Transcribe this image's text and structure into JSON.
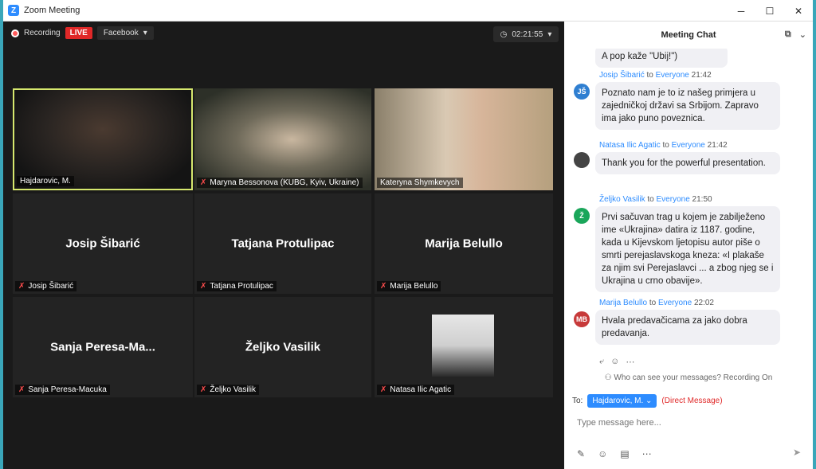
{
  "window": {
    "title": "Zoom Meeting",
    "logo": "Z"
  },
  "top": {
    "recording_label": "Recording",
    "live_label": "LIVE",
    "platform": "Facebook",
    "timer": "02:21:55"
  },
  "tiles": [
    {
      "label": "Hajdarovic, M.",
      "center": "",
      "muted": false
    },
    {
      "label": "Maryna Bessonova (KUBG, Kyiv, Ukraine)",
      "center": "",
      "muted": true
    },
    {
      "label": "Kateryna Shymkevych",
      "center": "",
      "muted": false
    },
    {
      "label": "Josip Šibarić",
      "center": "Josip Šibarić",
      "muted": true
    },
    {
      "label": "Tatjana Protulipac",
      "center": "Tatjana Protulipac",
      "muted": true
    },
    {
      "label": "Marija Belullo",
      "center": "Marija Belullo",
      "muted": true
    },
    {
      "label": "Sanja Peresa-Macuka",
      "center": "Sanja  Peresa-Ma...",
      "muted": true
    },
    {
      "label": "Željko Vasilik",
      "center": "Željko Vasilik",
      "muted": true
    },
    {
      "label": "Natasa Ilic Agatic",
      "center": "",
      "muted": true
    }
  ],
  "chat": {
    "title": "Meeting Chat",
    "messages": [
      {
        "sender": "",
        "to": "",
        "target": "",
        "time": "",
        "initials": "",
        "text": "A pop kaže \"Ubij!\")"
      },
      {
        "sender": "Josip Šibarić",
        "to": "to",
        "target": "Everyone",
        "time": "21:42",
        "initials": "JŠ",
        "text": "Poznato nam je to iz našeg primjera u zajedničkoj državi sa Srbijom. Zapravo ima jako puno poveznica."
      },
      {
        "sender": "Natasa Ilic Agatic",
        "to": "to",
        "target": "Everyone",
        "time": "21:42",
        "initials": "",
        "text": "Thank you for the powerful presentation."
      },
      {
        "sender": "Željko Vasilik",
        "to": "to",
        "target": "Everyone",
        "time": "21:50",
        "initials": "Ž",
        "text": "Prvi sačuvan trag u kojem je zabilježeno ime «Ukrajina» datira iz 1187. godine, kada u Kijevskom ljetopisu autor piše o smrti perejaslavskoga kneza: «I plakaše za njim svi Perejaslavci ... a zbog njeg se i Ukrajina u crno obavije»."
      },
      {
        "sender": "Marija Belullo",
        "to": "to",
        "target": "Everyone",
        "time": "22:02",
        "initials": "MB",
        "text": "Hvala predavačicama za jako dobra predavanja."
      }
    ],
    "who_can_see": "Who can see your messages? Recording On",
    "to_label": "To:",
    "recipient": "Hajdarovic, M.",
    "direct": "(Direct Message)",
    "placeholder": "Type message here..."
  },
  "colors": {
    "accent": "#2d8cff",
    "live": "#e02828",
    "active_border": "#d6e86e"
  }
}
